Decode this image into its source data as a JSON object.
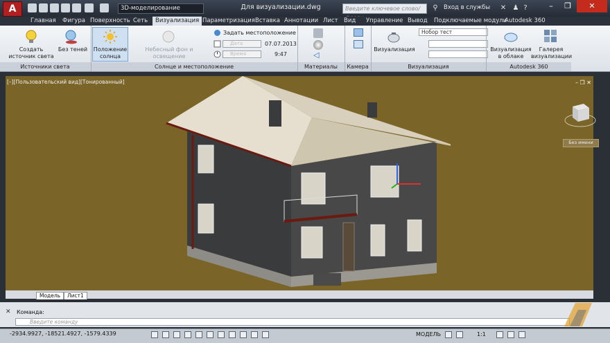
{
  "titlebar": {
    "app_logo": "A",
    "workspace": "3D-моделирование",
    "document_title": "Для визуализации.dwg",
    "search_placeholder": "Введите ключевое слово/фразу",
    "signin": "Вход в службы"
  },
  "tabs": [
    "Главная",
    "Фигура",
    "Поверхность",
    "Сеть",
    "Визуализация",
    "Параметризация",
    "Вставка",
    "Аннотации",
    "Лист",
    "Вид",
    "Управление",
    "Вывод",
    "Подключаемые модули",
    "Autodesk 360"
  ],
  "active_tab": "Визуализация",
  "ribbon": {
    "create_light": "Создать источник света",
    "no_shadows": "Без теней",
    "sun_position": "Положение солнца",
    "sky_background": "Небесный фон и освещение",
    "set_location": "Задать местоположение",
    "date_label": "Дата",
    "date_value": "07.07.2013",
    "time_label": "Время",
    "time_value": "9:47",
    "render": "Визуализация",
    "render_preset": "Нобор тест",
    "cloud_render": "Визуализация в облаке",
    "render_gallery": "Галерея визуализации"
  },
  "panels": {
    "lights": "Источники света",
    "sun": "Солнце и местоположение",
    "materials": "Материалы",
    "camera": "Камера",
    "render": "Визуализация",
    "a360": "Autodesk 360"
  },
  "viewport": {
    "label": "[–][Пользовательский вид][Тонированный]",
    "viewcube_label": "Без имени"
  },
  "layout_tabs": [
    "Модель",
    "Лист1"
  ],
  "command": {
    "history": "Команда:",
    "placeholder": "Введите команду"
  },
  "statusbar": {
    "coords": "-2934.9927, -18521.4927, -1579.4339",
    "model": "МОДЕЛЬ",
    "scale": "1:1"
  },
  "colors": {
    "viewport_bg": "#7a6428",
    "active_tab": "#dde3ea",
    "roof": "#e6dfcf",
    "walls": "#3b3c3c"
  }
}
